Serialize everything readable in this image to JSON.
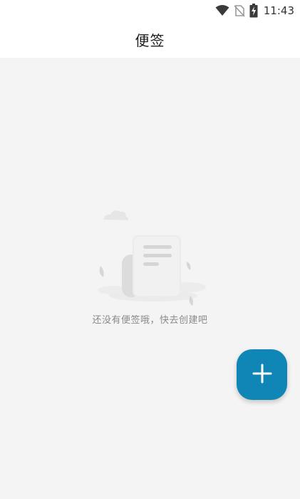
{
  "status_bar": {
    "time": "11:43",
    "icons": [
      "wifi-icon",
      "no-sim-icon",
      "battery-charging-icon"
    ]
  },
  "header": {
    "title": "便签"
  },
  "empty_state": {
    "icon": "empty-note-illustration",
    "message": "还没有便签哦，快去创建吧"
  },
  "fab": {
    "icon": "plus-icon"
  },
  "colors": {
    "accent": "#0f86b5",
    "background": "#f4f4f4",
    "header_bg": "#ffffff",
    "message_text": "#8a8a8a"
  }
}
